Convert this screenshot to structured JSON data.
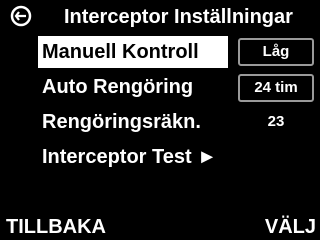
{
  "header": {
    "logo_icon": "brand-logo-icon",
    "title": "Interceptor Inställningar"
  },
  "menu": {
    "items": [
      {
        "label": "Manuell Kontroll",
        "value": "Låg",
        "selected": true
      },
      {
        "label": "Auto Rengöring",
        "value": "24 tim",
        "selected": false
      },
      {
        "label": "Rengöringsräkn.",
        "value": "23",
        "selected": false
      },
      {
        "label": "Interceptor Test ►",
        "value": "",
        "selected": false
      }
    ]
  },
  "softkeys": {
    "left": "TILLBAKA",
    "right": "VÄLJ"
  },
  "colors": {
    "background": "#000000",
    "text": "#ffffff",
    "highlight": "#ffffff",
    "highlight_text": "#000000",
    "box_border": "#9a9a9a"
  }
}
